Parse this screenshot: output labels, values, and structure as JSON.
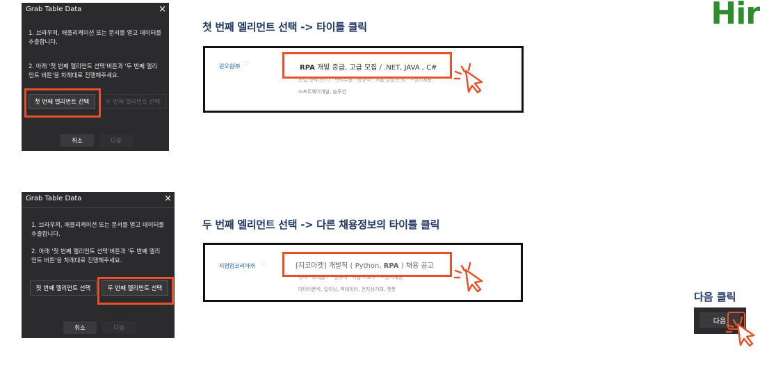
{
  "brand": "Hir",
  "dialog_top": {
    "title": "Grab Table Data",
    "close": "×",
    "instruction1_line1": "1. 브라우저, 애플리케이션 또는 문서를 열고 데이터를",
    "instruction1_line2": "추출합니다.",
    "instruction2_line1": "2. 아래 '첫 번째 엘리먼트 선택'버튼과 '두 번째 엘리",
    "instruction2_line2": "먼트 버튼'을 차례대로 진행해주세요.",
    "btn_first": "첫 번째 엘리먼트 선택",
    "btn_second": "두 번째 엘리먼트 선택",
    "btn_cancel": "취소",
    "btn_next": "다음"
  },
  "dialog_bottom": {
    "title": "Grab Table Data",
    "close": "×",
    "instruction1_line1": "1. 브라우저, 애플리케이션 또는 문서를 열고 데이터를",
    "instruction1_line2": "추출합니다.",
    "instruction2_line1": "2. 아래 '첫 번째 엘리먼트 선택'버튼과 '두 번째 엘리",
    "instruction2_line2": "먼트 버튼'을 차례대로 진행해주세요.",
    "btn_first": "첫 번째 엘리먼트 선택",
    "btn_second": "두 번째 엘리먼트 선택",
    "btn_cancel": "취소",
    "btn_next": "다음"
  },
  "step1": {
    "heading": "첫 번째 엘리먼트 선택 -> 타이틀 클릭",
    "company": "원오원㈜",
    "heart": "♡",
    "title_bold": "RPA",
    "title_rest": " 개발 중급, 고급 모집 / .NET, JAVA , C#",
    "meta": "신입·경력(년↑) · 학력무관 · 정규직 · 서울 강남구 외 · ~상시채용",
    "tags": "소프트웨어개발, 솔루션"
  },
  "step2": {
    "heading": "두 번째 엘리먼트 선택 -> 다른 채용정보의 타이틀 클릭",
    "company": "지엄업코리아㈜",
    "heart": "♡",
    "title_pre": "[지코마켓] 개발직 ( Python, ",
    "title_bold": "RPA",
    "title_post": " ) 채용 공고",
    "meta": "경력 · 초대졸↑ · 정규직 · 서울 마포구 · ~상시채용",
    "tags": "데이터분석, 입라닝, 빅데이터, 전자상거래, 챗봇"
  },
  "next_step": {
    "label": "다음 클릭",
    "button": "다음"
  },
  "colors": {
    "highlight": "#e8512a",
    "heading": "#1f3864",
    "brand": "#2e8b2e",
    "dialog_bg": "#2b2b2d"
  }
}
